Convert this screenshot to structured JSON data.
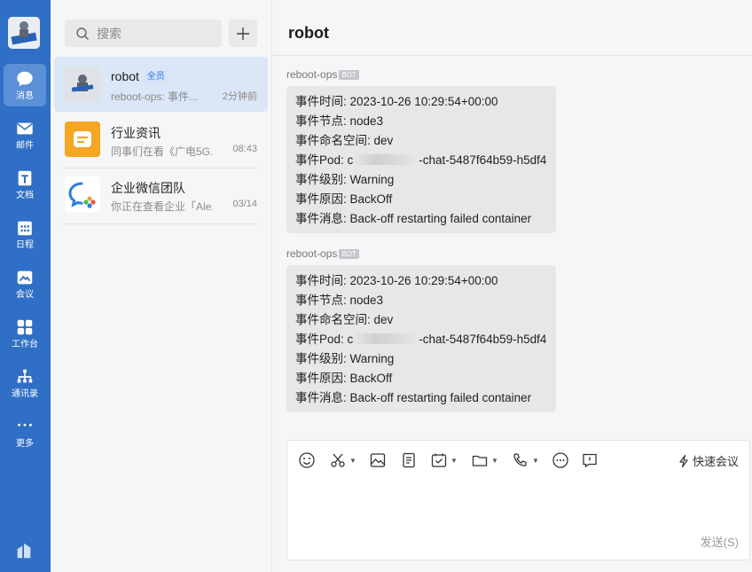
{
  "rail": {
    "items": [
      {
        "label": "消息",
        "icon": "chat-bubble-icon",
        "active": true
      },
      {
        "label": "邮件",
        "icon": "mail-icon"
      },
      {
        "label": "文档",
        "icon": "document-icon"
      },
      {
        "label": "日程",
        "icon": "calendar-icon"
      },
      {
        "label": "会议",
        "icon": "meeting-icon"
      },
      {
        "label": "工作台",
        "icon": "workbench-icon"
      },
      {
        "label": "通讯录",
        "icon": "contacts-icon"
      },
      {
        "label": "更多",
        "icon": "more-icon"
      }
    ]
  },
  "search": {
    "placeholder": "搜索"
  },
  "conversations": [
    {
      "title": "robot",
      "badge": "全员",
      "subtitle": "reboot-ops: 事件...",
      "time": "2分钟前",
      "avatar": "robot-avatar",
      "active": true
    },
    {
      "title": "行业资讯",
      "subtitle": "同事们在看《广电5G...",
      "time": "08:43",
      "avatar": "news-icon"
    },
    {
      "title": "企业微信团队",
      "subtitle": "你正在查看企业「Ale...",
      "time": "03/14",
      "avatar": "wecom-logo-icon"
    }
  ],
  "chat": {
    "title": "robot",
    "messages": [
      {
        "sender": "reboot-ops",
        "tag": "BOT",
        "lines": {
          "time": "事件时间: 2023-10-26 10:29:54+00:00",
          "node": "事件节点: node3",
          "namespace": "事件命名空间: dev",
          "pod_prefix": "事件Pod: c",
          "pod_suffix": "-chat-5487f64b59-h5df4",
          "level": "事件级别: Warning",
          "reason": "事件原因: BackOff",
          "message": "事件消息: Back-off restarting failed container"
        }
      },
      {
        "sender": "reboot-ops",
        "tag": "BOT",
        "lines": {
          "time": "事件时间: 2023-10-26 10:29:54+00:00",
          "node": "事件节点: node3",
          "namespace": "事件命名空间: dev",
          "pod_prefix": "事件Pod: c",
          "pod_suffix": "-chat-5487f64b59-h5df4",
          "level": "事件级别: Warning",
          "reason": "事件原因: BackOff",
          "message": "事件消息: Back-off restarting failed container"
        }
      }
    ]
  },
  "composer": {
    "quick_meeting": "快速会议",
    "send": "发送(S)"
  },
  "colors": {
    "rail": "#2f6fc5",
    "active_conv": "#dbe6f6",
    "news_avatar": "#f5a623"
  }
}
